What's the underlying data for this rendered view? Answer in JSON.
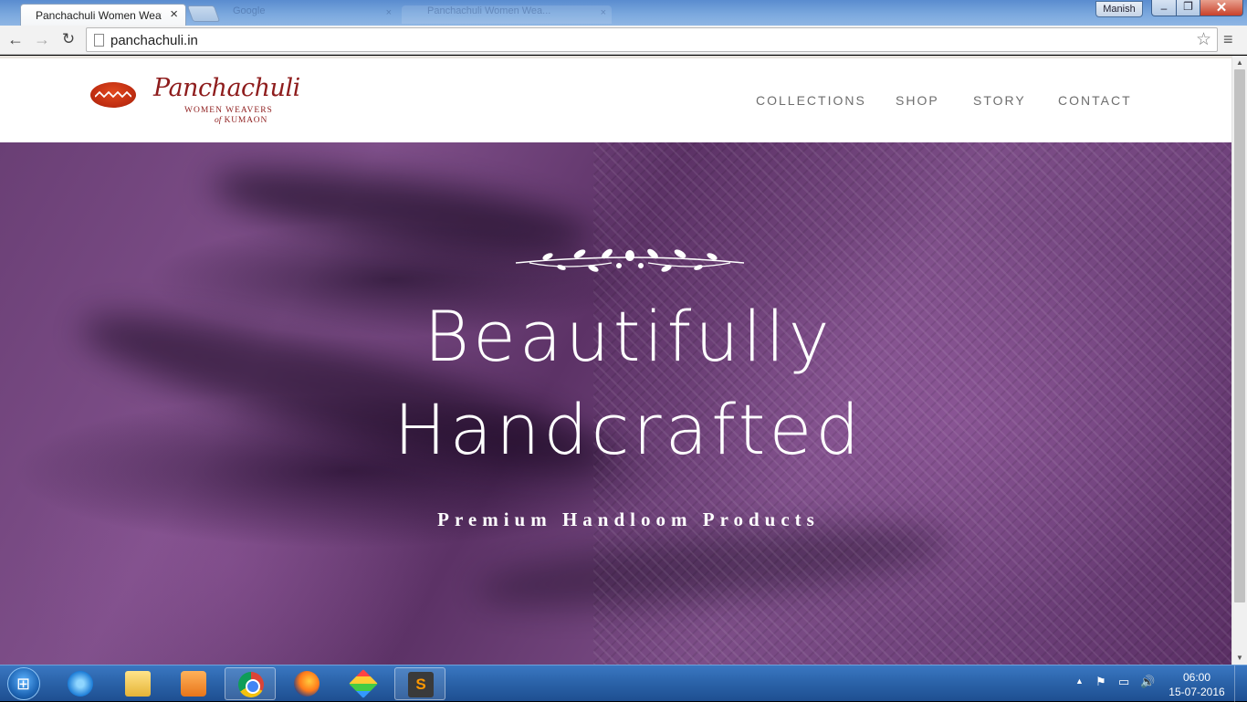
{
  "browser": {
    "tab_title": "Panchachuli Women Weav",
    "tab_close": "×",
    "ghost_tab_1": "Google",
    "ghost_tab_2": "Panchachuli Women Wea...",
    "ghost_tab_close": "×",
    "user_name": "Manish",
    "url": "panchachuli.in",
    "back_glyph": "←",
    "forward_glyph": "→",
    "reload_glyph": "↻",
    "star_glyph": "☆",
    "menu_glyph": "≡",
    "minimize_glyph": "–",
    "maximize_glyph": "❐",
    "close_glyph": "✕"
  },
  "site": {
    "logo": {
      "title": "Panchachuli",
      "subtitle_1": "WOMEN WEAVERS",
      "subtitle_2_of": "of",
      "subtitle_2": "KUMAON"
    },
    "nav": [
      "COLLECTIONS",
      "SHOP",
      "STORY",
      "CONTACT"
    ],
    "hero": {
      "line1": "Beautifully",
      "line2": "Handcrafted",
      "subtitle": "Premium Handloom Products"
    }
  },
  "taskbar": {
    "start_glyph": "⊞",
    "items": [
      "internet-explorer-icon",
      "file-explorer-icon",
      "media-player-icon",
      "chrome-icon",
      "firefox-icon",
      "bluestacks-icon",
      "sublime-text-icon"
    ],
    "active_item": "chrome-icon",
    "sublime_glyph": "S",
    "tray_up_glyph": "▲",
    "tray_flag_glyph": "⚑",
    "tray_network_glyph": "▭",
    "tray_volume_glyph": "🔊",
    "time": "06:00",
    "date": "15-07-2016"
  },
  "colors": {
    "brand": "#8e1c1c",
    "logo_mark": "#c22f12",
    "hero_base": "#6a3f75",
    "nav_text": "#6e6e6e"
  }
}
